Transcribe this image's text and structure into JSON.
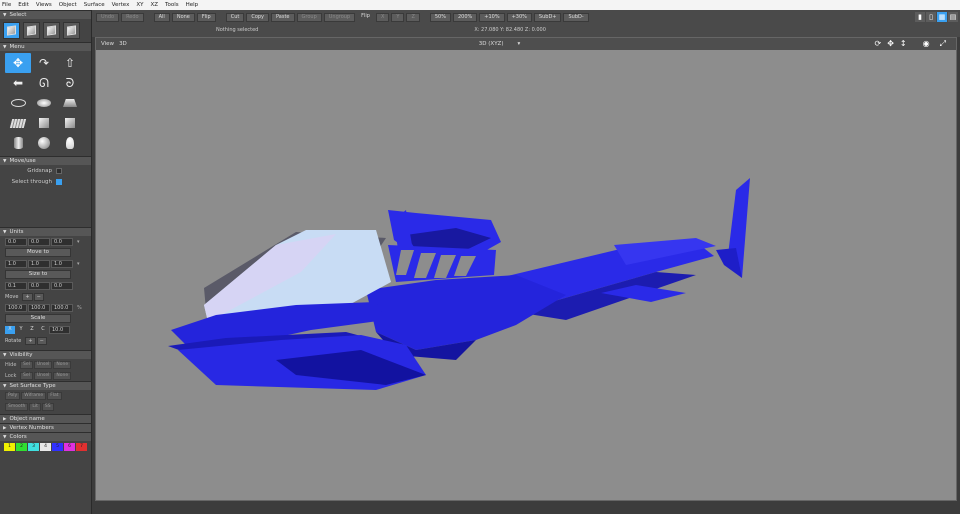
{
  "menu": [
    "File",
    "Edit",
    "Views",
    "Object",
    "Surface",
    "Vertex",
    "XY",
    "XZ",
    "Tools",
    "Help"
  ],
  "toolbar": {
    "row1": [
      "Undo",
      "Redo",
      "All",
      "None",
      "Flip",
      "Cut",
      "Copy",
      "Paste",
      "Group",
      "Ungroup",
      "Flip",
      "X",
      "Y",
      "Z",
      "50%",
      "200%",
      "+10%",
      "+30%",
      "SubD+",
      "SubD-"
    ],
    "status": "Nothing selected",
    "coords": "X: 27.080 Y: 82.480 Z: 0.000"
  },
  "panels": {
    "select_title": "Select",
    "menu_title": "Menu",
    "manipulate_title": "Move/use",
    "gridsnap_label": "Gridsnap",
    "select_through_label": "Select through",
    "units_title": "Units",
    "move_row": [
      "0.0",
      "0.0",
      "0.0"
    ],
    "move_to_label": "Move to",
    "size_row": [
      "1.0",
      "1.0",
      "1.0"
    ],
    "size_to_label": "Size to",
    "step_row": [
      "0.1",
      "0.0",
      "0.0"
    ],
    "move_label": "Move",
    "scale_row": [
      "100.0",
      "100.0",
      "100.0"
    ],
    "percent": "%",
    "scale_label": "Scale",
    "axes": [
      "X",
      "Y",
      "Z",
      "C"
    ],
    "axis_value": "10.0",
    "rotate_label": "Rotate",
    "visibility_title": "Visibility",
    "hide_label": "Hide",
    "lock_label": "Lock",
    "vis_opts": [
      "Sel",
      "Unsel",
      "None"
    ],
    "surface_type_title": "Set Surface Type",
    "surface_types": [
      "Poly",
      "Wiframe",
      "Flat",
      "Smooth",
      "Lit",
      "SS"
    ],
    "object_name_title": "Object name",
    "vertex_numbers_title": "Vertex Numbers",
    "colors_title": "Colors",
    "palette_labels": [
      "1",
      "2",
      "3",
      "4",
      "5",
      "6",
      "7"
    ]
  },
  "viewport": {
    "label": "View",
    "mode": "3D",
    "projection": "3D (XYZ)"
  },
  "colors": {
    "accent": "#3aa0f0",
    "model_blue": "#2828e0",
    "canopy": "#b8d4f0"
  }
}
